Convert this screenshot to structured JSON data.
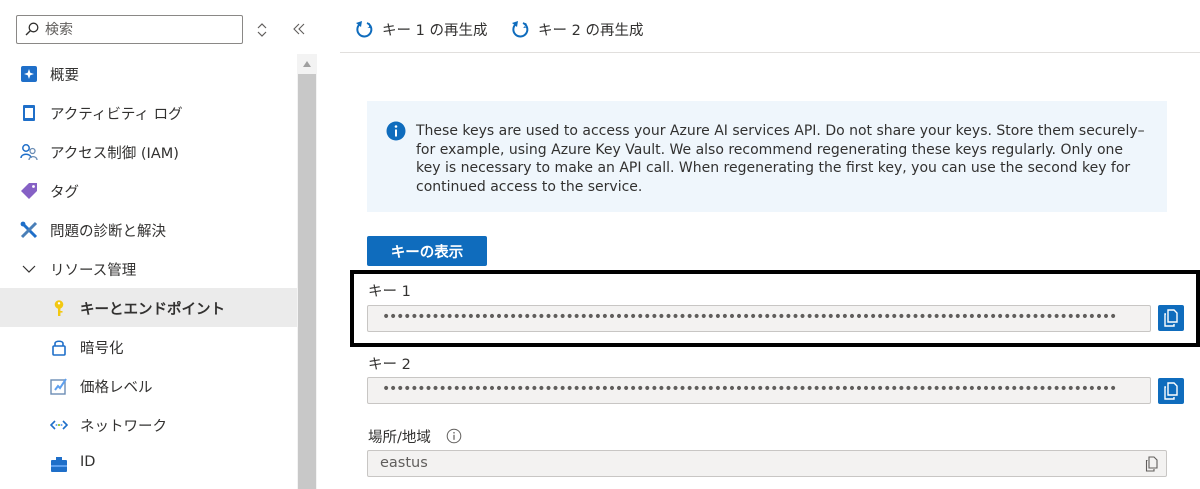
{
  "search": {
    "placeholder": "検索"
  },
  "nav": {
    "items": [
      {
        "label": "概要",
        "icon": "overview-icon"
      },
      {
        "label": "アクティビティ ログ",
        "icon": "activity-log-icon"
      },
      {
        "label": "アクセス制御 (IAM)",
        "icon": "access-control-icon"
      },
      {
        "label": "タグ",
        "icon": "tag-icon"
      },
      {
        "label": "問題の診断と解決",
        "icon": "diagnose-icon"
      },
      {
        "label": "リソース管理",
        "icon": "chevron-down-icon"
      },
      {
        "label": "キーとエンドポイント",
        "icon": "key-icon",
        "active": true
      },
      {
        "label": "暗号化",
        "icon": "lock-icon"
      },
      {
        "label": "価格レベル",
        "icon": "pricing-tier-icon"
      },
      {
        "label": "ネットワーク",
        "icon": "network-icon"
      },
      {
        "label": "ID",
        "icon": "identity-icon"
      }
    ]
  },
  "toolbar": {
    "regen_key1": "キー 1 の再生成",
    "regen_key2": "キー 2 の再生成"
  },
  "info": {
    "text": "These keys are used to access your Azure AI services API. Do not share your keys. Store them securely– for example, using Azure Key Vault. We also recommend regenerating these keys regularly. Only one key is necessary to make an API call. When regenerating the first key, you can use the second key for continued access to the service."
  },
  "show_keys_label": "キーの表示",
  "key1": {
    "label": "キー 1",
    "value": "••••••••••••••••••••••••••••••••••••••••••••••••••••••••••••••••••••••••••••••••••••••••••••••••••••••••"
  },
  "key2": {
    "label": "キー 2",
    "value": "••••••••••••••••••••••••••••••••••••••••••••••••••••••••••••••••••••••••••••••••••••••••••••••••••••••••"
  },
  "region": {
    "label": "場所/地域",
    "value": "eastus"
  },
  "colors": {
    "accent": "#0f6cbd",
    "info_bg": "#eff6fc",
    "active_bg": "#ebebeb"
  }
}
